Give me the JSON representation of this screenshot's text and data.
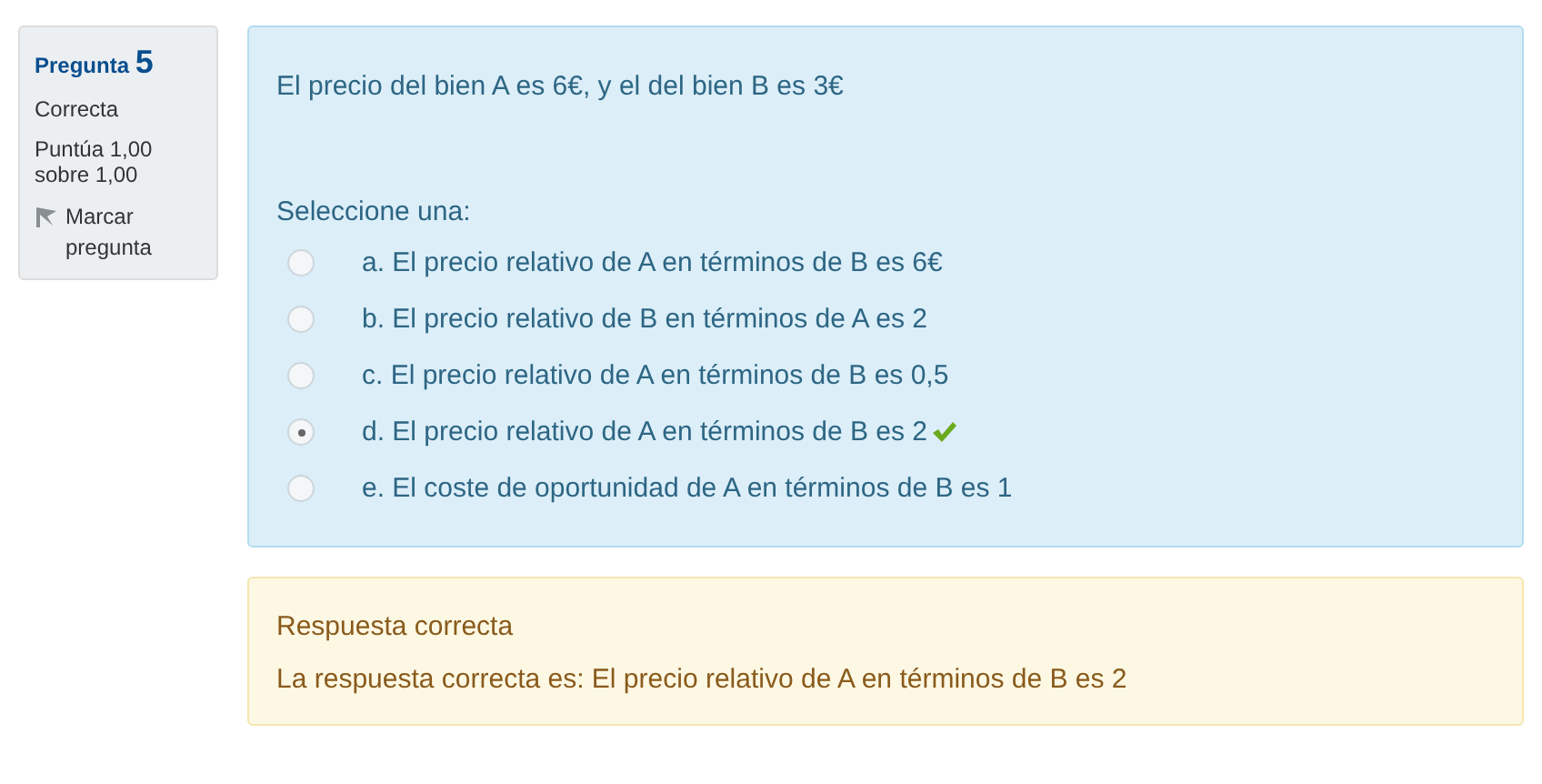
{
  "info": {
    "label": "Pregunta",
    "number": "5",
    "state": "Correcta",
    "grade": "Puntúa 1,00 sobre 1,00",
    "flag": "Marcar pregunta"
  },
  "question": {
    "text": "El precio del bien A es 6€, y el del bien B es 3€",
    "prompt": "Seleccione una:",
    "options": [
      {
        "label": "a. El precio relativo de A en términos de B es 6€",
        "selected": false,
        "correct": false
      },
      {
        "label": "b. El precio relativo de B en términos de A es 2",
        "selected": false,
        "correct": false
      },
      {
        "label": "c. El precio relativo de A en términos de B es 0,5",
        "selected": false,
        "correct": false
      },
      {
        "label": "d. El precio relativo de A en términos de B es 2",
        "selected": true,
        "correct": true
      },
      {
        "label": "e. El coste de oportunidad de A en términos de B es 1",
        "selected": false,
        "correct": false
      }
    ]
  },
  "feedback": {
    "title": "Respuesta correcta",
    "text": "La respuesta correcta es: El precio relativo de A en términos de B es 2"
  }
}
